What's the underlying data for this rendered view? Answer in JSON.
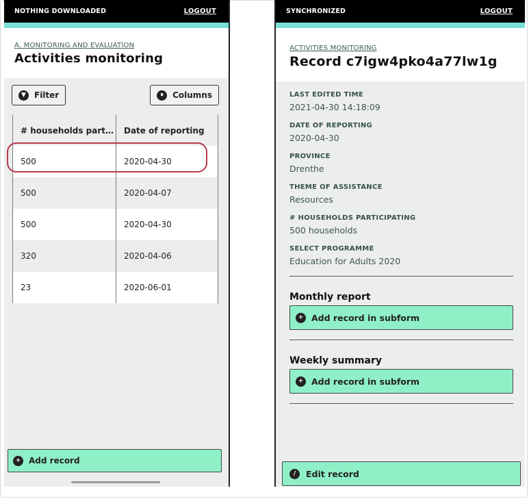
{
  "left": {
    "status": "NOTHING DOWNLOADED",
    "logout": "LOGOUT",
    "breadcrumb": "A. MONITORING AND EVALUATION",
    "title": "Activities monitoring",
    "filter_label": "Filter",
    "columns_label": "Columns",
    "table": {
      "headers": [
        "# households partici...",
        "Date of reporting"
      ],
      "rows": [
        [
          "500",
          "2020-04-30"
        ],
        [
          "500",
          "2020-04-07"
        ],
        [
          "500",
          "2020-04-30"
        ],
        [
          "320",
          "2020-04-06"
        ],
        [
          "23",
          "2020-06-01"
        ]
      ]
    },
    "add_record": "Add record"
  },
  "right": {
    "status": "SYNCHRONIZED",
    "logout": "LOGOUT",
    "breadcrumb": "ACTIVITIES MONITORING",
    "title": "Record c7igw4pko4a77lw1g",
    "fields": [
      {
        "label": "LAST EDITED TIME",
        "value": "2021-04-30 14:18:09"
      },
      {
        "label": "DATE OF REPORTING",
        "value": "2020-04-30"
      },
      {
        "label": "PROVINCE",
        "value": "Drenthe"
      },
      {
        "label": "THEME OF ASSISTANCE",
        "value": "Resources"
      },
      {
        "label": "# HOUSEHOLDS PARTICIPATING",
        "value": "500 households"
      },
      {
        "label": "SELECT PROGRAMME",
        "value": "Education for Adults 2020"
      }
    ],
    "subforms": [
      {
        "title": "Monthly report",
        "button": "Add record in subform"
      },
      {
        "title": "Weekly summary",
        "button": "Add record in subform"
      }
    ],
    "edit_record": "Edit record"
  },
  "colors": {
    "accent": "#78ded8",
    "action_green": "#8ff0c8",
    "highlight": "#b7374d",
    "status_bar": "#000000"
  },
  "icons": {
    "filter": "filter-icon",
    "columns": "columns-icon",
    "add": "plus-circle-icon",
    "edit": "edit-icon"
  }
}
